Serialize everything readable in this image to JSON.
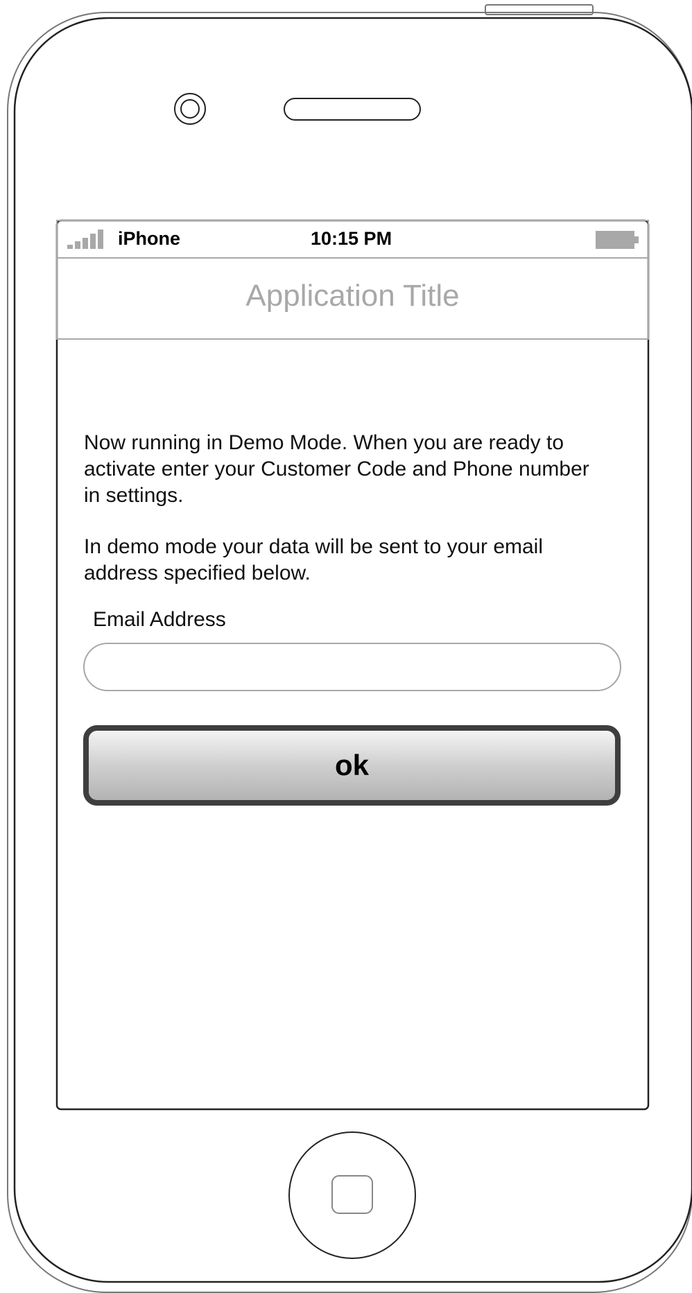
{
  "status_bar": {
    "carrier": "iPhone",
    "time": "10:15 PM",
    "signal_icon": "signal-bars-icon",
    "battery_icon": "battery-icon"
  },
  "nav": {
    "title": "Application Title"
  },
  "main": {
    "paragraph_1": "Now running in Demo Mode. When you are ready to activate enter your Customer Code and Phone number in settings.",
    "paragraph_2": "In demo mode your data will be sent to your email address specified below.",
    "email_label": "Email Address",
    "email_value": "",
    "ok_label": "ok"
  },
  "colors": {
    "frame_stroke": "#222222",
    "muted_gray": "#a8a8a8",
    "button_border": "#3e3e3e"
  }
}
